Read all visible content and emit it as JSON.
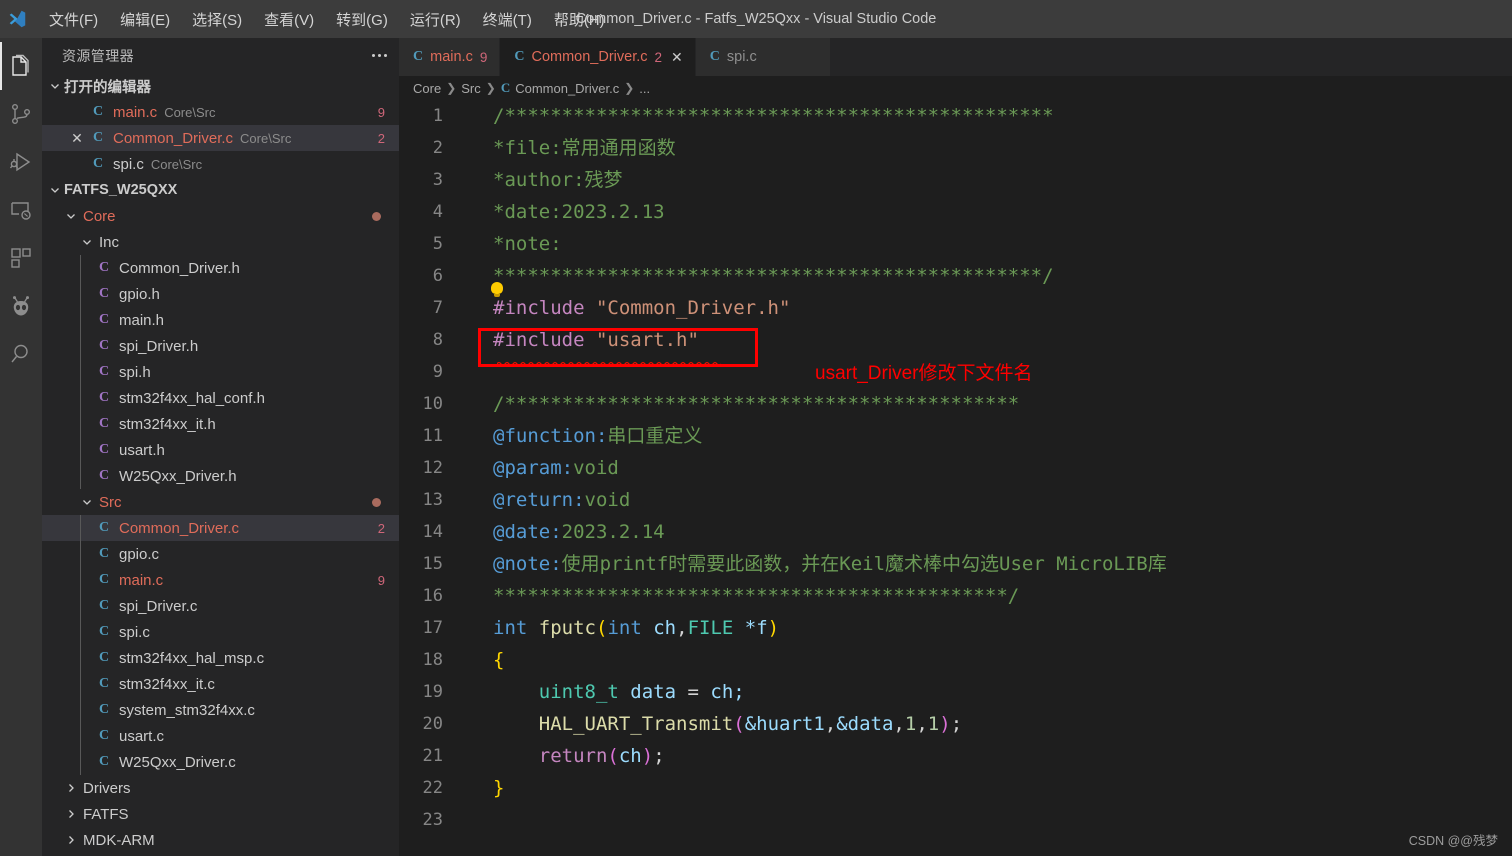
{
  "window": {
    "title": "Common_Driver.c - Fatfs_W25Qxx - Visual Studio Code"
  },
  "menu": {
    "items": [
      {
        "label": "文件(F)",
        "name": "menu-file"
      },
      {
        "label": "编辑(E)",
        "name": "menu-edit"
      },
      {
        "label": "选择(S)",
        "name": "menu-selection"
      },
      {
        "label": "查看(V)",
        "name": "menu-view"
      },
      {
        "label": "转到(G)",
        "name": "menu-go"
      },
      {
        "label": "运行(R)",
        "name": "menu-run"
      },
      {
        "label": "终端(T)",
        "name": "menu-terminal"
      },
      {
        "label": "帮助(H)",
        "name": "menu-help"
      }
    ]
  },
  "activity_bar": {
    "items": [
      {
        "icon": "files-explorer-icon",
        "active": true
      },
      {
        "icon": "source-control-icon",
        "active": false
      },
      {
        "icon": "run-and-debug-icon",
        "active": false
      },
      {
        "icon": "terminal-task-icon",
        "active": false
      },
      {
        "icon": "extensions-icon",
        "active": false
      },
      {
        "icon": "platformio-alien-icon",
        "active": false
      },
      {
        "icon": "search-icon",
        "active": false
      }
    ]
  },
  "sidebar": {
    "title": "资源管理器",
    "more_actions": "...",
    "open_editors": {
      "header": "打开的编辑器",
      "expanded": true,
      "items": [
        {
          "name": "main.c",
          "path": "Core\\Src",
          "badge": "9",
          "icon": "c-source-icon",
          "error": true,
          "selected": false,
          "closable": false
        },
        {
          "name": "Common_Driver.c",
          "path": "Core\\Src",
          "badge": "2",
          "icon": "c-source-icon",
          "error": true,
          "selected": true,
          "closable": true
        },
        {
          "name": "spi.c",
          "path": "Core\\Src",
          "badge": "",
          "icon": "c-source-icon",
          "error": false,
          "selected": false,
          "closable": false
        }
      ]
    },
    "project": {
      "name": "FATFS_W25QXX",
      "expanded": true,
      "tree": [
        {
          "label": "Core",
          "type": "folder",
          "depth": 1,
          "expanded": true,
          "error": true,
          "dot": true
        },
        {
          "label": "Inc",
          "type": "folder",
          "depth": 2,
          "expanded": true,
          "error": false,
          "dot": false
        },
        {
          "label": "Common_Driver.h",
          "type": "header",
          "depth": 3,
          "badge": "",
          "error": false
        },
        {
          "label": "gpio.h",
          "type": "header",
          "depth": 3,
          "badge": "",
          "error": false
        },
        {
          "label": "main.h",
          "type": "header",
          "depth": 3,
          "badge": "",
          "error": false
        },
        {
          "label": "spi_Driver.h",
          "type": "header",
          "depth": 3,
          "badge": "",
          "error": false
        },
        {
          "label": "spi.h",
          "type": "header",
          "depth": 3,
          "badge": "",
          "error": false
        },
        {
          "label": "stm32f4xx_hal_conf.h",
          "type": "header",
          "depth": 3,
          "badge": "",
          "error": false
        },
        {
          "label": "stm32f4xx_it.h",
          "type": "header",
          "depth": 3,
          "badge": "",
          "error": false
        },
        {
          "label": "usart.h",
          "type": "header",
          "depth": 3,
          "badge": "",
          "error": false
        },
        {
          "label": "W25Qxx_Driver.h",
          "type": "header",
          "depth": 3,
          "badge": "",
          "error": false
        },
        {
          "label": "Src",
          "type": "folder",
          "depth": 2,
          "expanded": true,
          "error": true,
          "dot": true
        },
        {
          "label": "Common_Driver.c",
          "type": "source",
          "depth": 3,
          "badge": "2",
          "error": true,
          "selected": true
        },
        {
          "label": "gpio.c",
          "type": "source",
          "depth": 3,
          "badge": "",
          "error": false
        },
        {
          "label": "main.c",
          "type": "source",
          "depth": 3,
          "badge": "9",
          "error": true
        },
        {
          "label": "spi_Driver.c",
          "type": "source",
          "depth": 3,
          "badge": "",
          "error": false
        },
        {
          "label": "spi.c",
          "type": "source",
          "depth": 3,
          "badge": "",
          "error": false
        },
        {
          "label": "stm32f4xx_hal_msp.c",
          "type": "source",
          "depth": 3,
          "badge": "",
          "error": false
        },
        {
          "label": "stm32f4xx_it.c",
          "type": "source",
          "depth": 3,
          "badge": "",
          "error": false
        },
        {
          "label": "system_stm32f4xx.c",
          "type": "source",
          "depth": 3,
          "badge": "",
          "error": false
        },
        {
          "label": "usart.c",
          "type": "source",
          "depth": 3,
          "badge": "",
          "error": false
        },
        {
          "label": "W25Qxx_Driver.c",
          "type": "source",
          "depth": 3,
          "badge": "",
          "error": false
        },
        {
          "label": "Drivers",
          "type": "folder",
          "depth": 1,
          "expanded": false,
          "error": false,
          "dot": false
        },
        {
          "label": "FATFS",
          "type": "folder",
          "depth": 1,
          "expanded": false,
          "error": false,
          "dot": false
        },
        {
          "label": "MDK-ARM",
          "type": "folder",
          "depth": 1,
          "expanded": false,
          "error": false,
          "dot": false
        }
      ]
    }
  },
  "editor": {
    "tabs": [
      {
        "label": "main.c",
        "badge": "9",
        "active": false,
        "error": true,
        "closable": false,
        "icon": "c-source-icon"
      },
      {
        "label": "Common_Driver.c",
        "badge": "2",
        "active": true,
        "error": true,
        "closable": true,
        "icon": "c-source-icon"
      },
      {
        "label": "spi.c",
        "badge": "",
        "active": false,
        "error": false,
        "closable": false,
        "icon": "c-source-icon"
      }
    ],
    "breadcrumb": [
      "Core",
      "Src",
      "Common_Driver.c",
      "..."
    ],
    "lines": [
      {
        "n": "1"
      },
      {
        "n": "2"
      },
      {
        "n": "3"
      },
      {
        "n": "4"
      },
      {
        "n": "5"
      },
      {
        "n": "6"
      },
      {
        "n": "7"
      },
      {
        "n": "8"
      },
      {
        "n": "9"
      },
      {
        "n": "10"
      },
      {
        "n": "11"
      },
      {
        "n": "12"
      },
      {
        "n": "13"
      },
      {
        "n": "14"
      },
      {
        "n": "15"
      },
      {
        "n": "16"
      },
      {
        "n": "17"
      },
      {
        "n": "18"
      },
      {
        "n": "19"
      },
      {
        "n": "20"
      },
      {
        "n": "21"
      },
      {
        "n": "22"
      },
      {
        "n": "23"
      }
    ],
    "source_text": {
      "l1": "/************************************************",
      "l2_star": "*file:",
      "l2_rest": "常用通用函数",
      "l3_star": "*author:",
      "l3_rest": "残梦",
      "l4": "*date:2023.2.13",
      "l5": "*note:",
      "l6": "************************************************/",
      "l7_pp": "#include",
      "l7_str": "\"Common_Driver.h\"",
      "l8_pp": "#include",
      "l8_str": "\"usart.h\"",
      "l10": "/*********************************************",
      "l11_tag": "@function:",
      "l11_val": "串口重定义",
      "l12_tag": "@param:",
      "l12_val": "void",
      "l13_tag": "@return:",
      "l13_val": "void",
      "l14_tag": "@date:",
      "l14_val": "2023.2.14",
      "l15_tag": "@note:",
      "l15_val": "使用printf时需要此函数，并在Keil魔术棒中勾选User MicroLIB库",
      "l16": "*********************************************/",
      "l17_int": "int",
      "l17_fn": "fputc",
      "l17_p1": "(",
      "l17_int2": "int",
      "l17_ch": "ch",
      "l17_comma": ",",
      "l17_file": "FILE",
      "l17_star": "*f",
      "l17_p2": ")",
      "l18": "{",
      "l19_type": "uint8_t",
      "l19_var": "data",
      "l19_eq": "=",
      "l19_val": "ch;",
      "l20_fn": "HAL_UART_Transmit",
      "l20_p1": "(",
      "l20_a1": "&huart1",
      "l20_c1": ",",
      "l20_a2": "&data",
      "l20_c2": ",",
      "l20_n1": "1",
      "l20_c3": ",",
      "l20_n2": "1",
      "l20_p2": ")",
      "l20_semi": ";",
      "l21_ret": "return",
      "l21_p1": "(",
      "l21_ch": "ch",
      "l21_p2": ")",
      "l21_semi": ";",
      "l22": "}"
    },
    "annotation": {
      "text": "usart_Driver修改下文件名",
      "color": "#ff0000",
      "box_around_line": "8"
    }
  },
  "watermark": "CSDN @@残梦",
  "colors": {
    "accent": "#007acc",
    "error": "#e06c5a",
    "annotation": "#ff0000",
    "editor_bg": "#1e1e1e",
    "sidebar_bg": "#252526",
    "titlebar_bg": "#3c3c3c",
    "activitybar_bg": "#333333"
  }
}
